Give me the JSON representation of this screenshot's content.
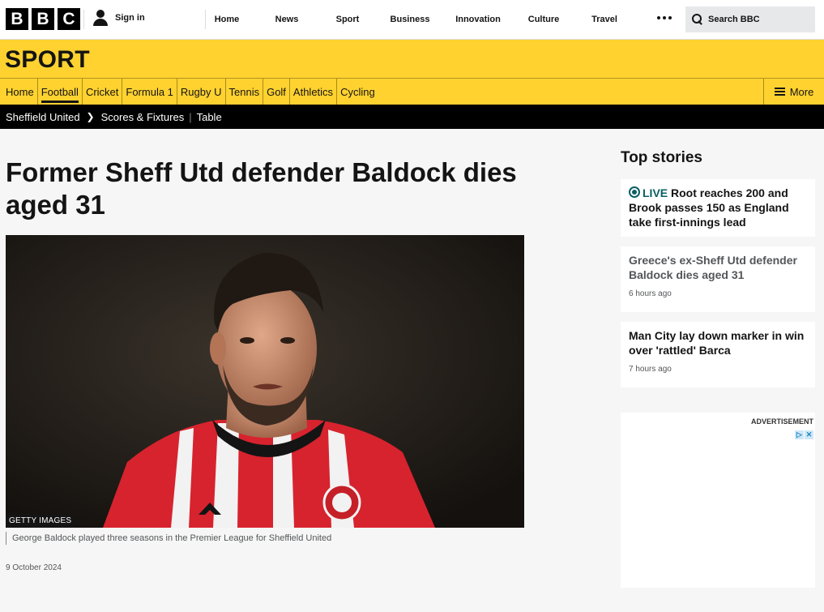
{
  "header": {
    "logo_letters": [
      "B",
      "B",
      "C"
    ],
    "sign_in": "Sign in",
    "nav": [
      "Home",
      "News",
      "Sport",
      "Business",
      "Innovation",
      "Culture",
      "Travel"
    ],
    "search_placeholder": "Search BBC"
  },
  "sport": {
    "title": "SPORT",
    "nav": [
      "Home",
      "Football",
      "Cricket",
      "Formula 1",
      "Rugby U",
      "Tennis",
      "Golf",
      "Athletics",
      "Cycling"
    ],
    "active_item": "Football",
    "more": "More",
    "subnav": {
      "team": "Sheffield United",
      "links": [
        "Scores & Fixtures",
        "Table"
      ]
    }
  },
  "article": {
    "headline": "Former Sheff Utd defender Baldock dies aged 31",
    "image_credit": "GETTY IMAGES",
    "caption": "George Baldock played three seasons in the Premier League for Sheffield United",
    "date": "9 October 2024"
  },
  "top_stories": {
    "title": "Top stories",
    "items": [
      {
        "live": "LIVE",
        "text": "Root reaches 200 and Brook passes 150 as England take first-innings lead",
        "ago": ""
      },
      {
        "live": "",
        "text": "Greece's ex-Sheff Utd defender Baldock dies aged 31",
        "ago": "6 hours ago"
      },
      {
        "live": "",
        "text": "Man City lay down marker in win over 'rattled' Barca",
        "ago": "7 hours ago"
      }
    ]
  },
  "ad": {
    "label": "ADVERTISEMENT"
  },
  "colors": {
    "sport_yellow": "#ffd230",
    "live_teal": "#0b5f64",
    "kit_red": "#d7232e"
  }
}
